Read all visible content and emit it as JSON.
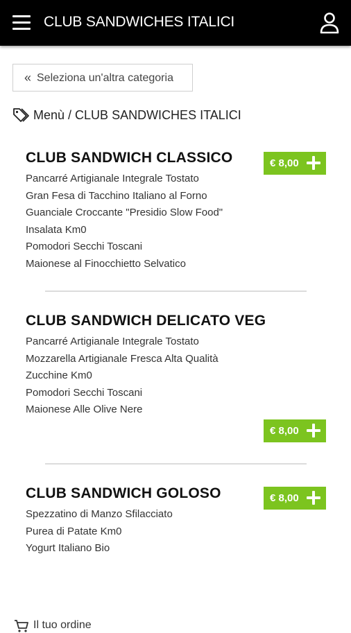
{
  "header": {
    "title": "CLUB SANDWICHES ITALICI",
    "menu_icon": "hamburger-menu-icon",
    "user_icon": "user-icon"
  },
  "back_button": {
    "icon": "double-chevron-left-icon",
    "label": "Seleziona un'altra categoria"
  },
  "breadcrumb": {
    "icon": "tag-icon",
    "root": "Menù",
    "separator": " / ",
    "current": "CLUB SANDWICHES ITALICI"
  },
  "products": [
    {
      "name": "CLUB SANDWICH CLASSICO",
      "price": "€ 8,00",
      "ingredients": [
        "Pancarré Artigianale Integrale Tostato",
        "Gran Fesa di Tacchino Italiano al Forno",
        "Guanciale Croccante \"Presidio Slow Food\"",
        "Insalata Km0",
        "Pomodori Secchi Toscani",
        "Maionese al Finocchietto Selvatico"
      ]
    },
    {
      "name": "CLUB SANDWICH DELICATO VEG",
      "price": "€ 8,00",
      "ingredients": [
        "Pancarré Artigianale Integrale Tostato",
        "Mozzarella Artigianale Fresca Alta Qualità",
        "Zucchine Km0",
        "Pomodori Secchi Toscani",
        "Maionese Alle Olive Nere"
      ]
    },
    {
      "name": "CLUB SANDWICH GOLOSO",
      "price": "€ 8,00",
      "ingredients": [
        "Spezzatino di Manzo Sfilacciato",
        "Purea di Patate Km0",
        "Yogurt Italiano Bio"
      ]
    }
  ],
  "cart": {
    "icon": "cart-icon",
    "label": "Il tuo ordine"
  },
  "colors": {
    "header_bg": "#000000",
    "accent_green": "#7cc41f",
    "divider": "#dcdcdc"
  }
}
